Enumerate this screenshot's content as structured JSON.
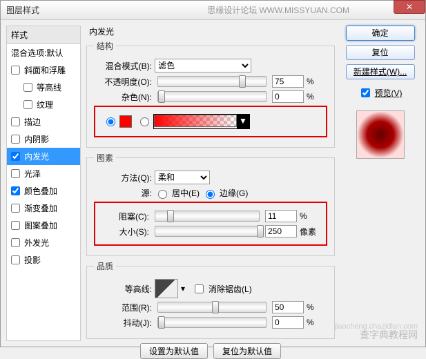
{
  "titlebar": {
    "title": "图层样式",
    "subtitle": "思缘设计论坛",
    "url": "WWW.MISSYUAN.COM"
  },
  "sidebar": {
    "header": "样式",
    "blending": "混合选项:默认",
    "items": [
      {
        "label": "斜面和浮雕",
        "checked": false
      },
      {
        "label": "等高线",
        "checked": false,
        "indent": true
      },
      {
        "label": "纹理",
        "checked": false,
        "indent": true
      },
      {
        "label": "描边",
        "checked": false
      },
      {
        "label": "内阴影",
        "checked": false
      },
      {
        "label": "内发光",
        "checked": true,
        "selected": true
      },
      {
        "label": "光泽",
        "checked": false
      },
      {
        "label": "颜色叠加",
        "checked": true
      },
      {
        "label": "渐变叠加",
        "checked": false
      },
      {
        "label": "图案叠加",
        "checked": false
      },
      {
        "label": "外发光",
        "checked": false
      },
      {
        "label": "投影",
        "checked": false
      }
    ]
  },
  "panel": {
    "title": "内发光",
    "structure": {
      "legend": "结构",
      "blendMode": {
        "label": "混合模式(B):",
        "value": "滤色"
      },
      "opacity": {
        "label": "不透明度(O):",
        "value": "75",
        "unit": "%",
        "pos": 75
      },
      "noise": {
        "label": "杂色(N):",
        "value": "0",
        "unit": "%",
        "pos": 0
      }
    },
    "elements": {
      "legend": "图素",
      "technique": {
        "label": "方法(Q):",
        "value": "柔和"
      },
      "source": {
        "label": "源:",
        "center": "居中(E)",
        "edge": "边缘(G)"
      },
      "choke": {
        "label": "阻塞(C):",
        "value": "11",
        "unit": "%",
        "pos": 11
      },
      "size": {
        "label": "大小(S):",
        "value": "250",
        "unit": "像素",
        "pos": 100
      }
    },
    "quality": {
      "legend": "品质",
      "contour": {
        "label": "等高线:",
        "antialias": "消除锯齿(L)"
      },
      "range": {
        "label": "范围(R):",
        "value": "50",
        "unit": "%",
        "pos": 50
      },
      "jitter": {
        "label": "抖动(J):",
        "value": "0",
        "unit": "%",
        "pos": 0
      }
    },
    "buttons": {
      "default": "设置为默认值",
      "reset": "复位为默认值"
    }
  },
  "right": {
    "ok": "确定",
    "cancel": "复位",
    "newStyle": "新建样式(W)...",
    "preview": "预览(V)"
  },
  "watermark": {
    "main": "查字典教程网",
    "sub": "jiaocheng.chazidian.com"
  }
}
